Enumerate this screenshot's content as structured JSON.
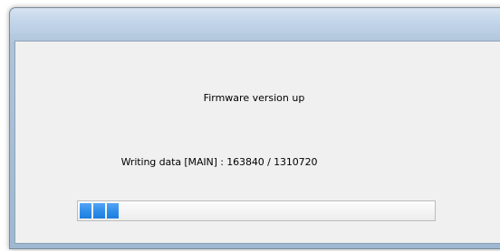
{
  "dialog": {
    "heading": "Firmware version up",
    "status_prefix": "Writing data [MAIN]  :",
    "bytes_written": "163840",
    "separator": "/",
    "bytes_total": "1310720"
  },
  "progress": {
    "fraction": 0.125,
    "chunks_visible": 3,
    "color": "#2e8de9"
  }
}
